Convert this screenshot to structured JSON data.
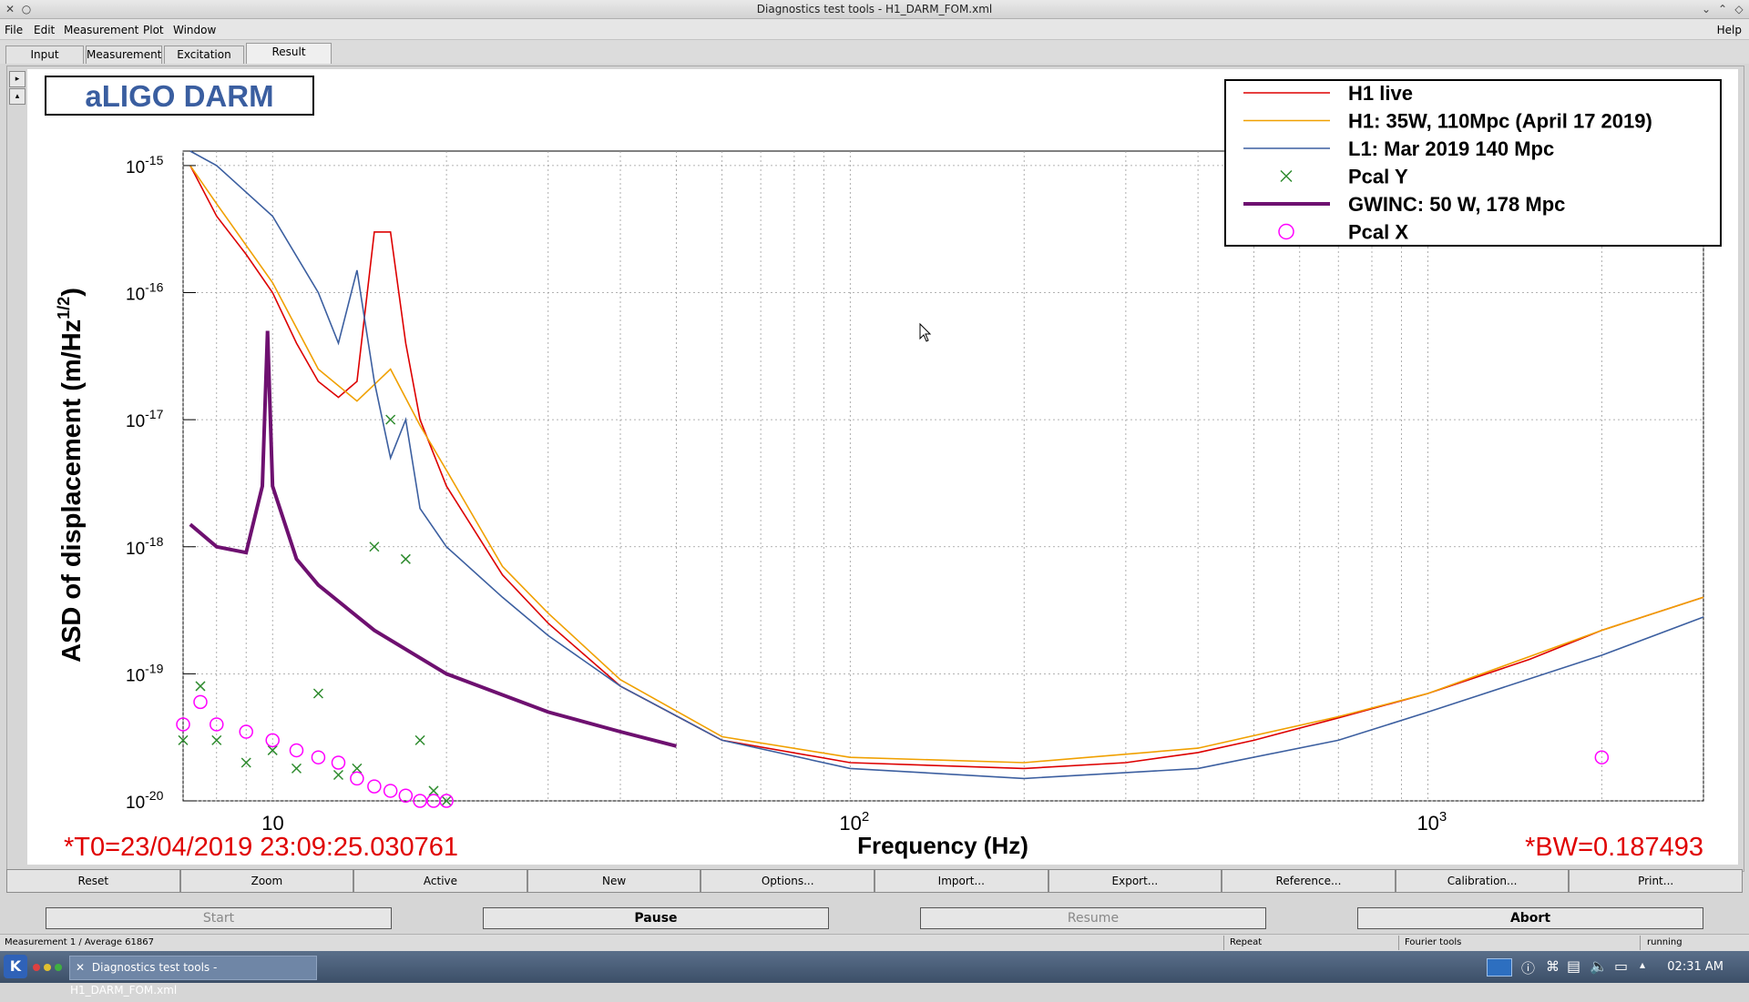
{
  "window": {
    "title": "Diagnostics test tools - H1_DARM_FOM.xml"
  },
  "menu": {
    "file": "File",
    "edit": "Edit",
    "measurement": "Measurement",
    "plot": "Plot",
    "window": "Window",
    "help": "Help"
  },
  "tabs": [
    {
      "label": "Input"
    },
    {
      "label": "Measurement"
    },
    {
      "label": "Excitation"
    },
    {
      "label": "Result"
    }
  ],
  "plot": {
    "badge": "aLIGO DARM",
    "t0": "*T0=23/04/2019 23:09:25.030761",
    "bw": "*BW=0.187493"
  },
  "chart_data": {
    "type": "line",
    "title": "",
    "xlabel": "Frequency (Hz)",
    "ylabel": "ASD of displacement (m/Hz",
    "ylabel_sup": "1/2",
    "ylabel_end": ")",
    "xscale": "log",
    "yscale": "log",
    "xlim": [
      7,
      3000
    ],
    "ylim": [
      1e-20,
      1.3e-15
    ],
    "grid": true,
    "legend_position": "top-right",
    "x_ticks": [
      {
        "label": "10",
        "exp": ""
      },
      {
        "label": "10",
        "exp": "2"
      },
      {
        "label": "10",
        "exp": "3"
      }
    ],
    "y_ticks": [
      {
        "base": "10",
        "exp": "-15"
      },
      {
        "base": "10",
        "exp": "-16"
      },
      {
        "base": "10",
        "exp": "-17"
      },
      {
        "base": "10",
        "exp": "-18"
      },
      {
        "base": "10",
        "exp": "-19"
      },
      {
        "base": "10",
        "exp": "-20"
      }
    ],
    "series": [
      {
        "name": "H1 live",
        "color": "#dd0000",
        "marker": "line",
        "x": [
          7.2,
          8,
          9,
          10,
          11,
          12,
          13,
          14,
          15,
          16,
          17,
          18,
          20,
          25,
          30,
          40,
          60,
          100,
          200,
          300,
          400,
          500,
          700,
          1000,
          1500,
          2000,
          3000
        ],
        "y": [
          1e-15,
          4e-16,
          2e-16,
          1e-16,
          4e-17,
          2e-17,
          1.5e-17,
          2e-17,
          3e-16,
          3e-16,
          4e-17,
          1e-17,
          3e-18,
          6e-19,
          2.5e-19,
          8e-20,
          3e-20,
          2e-20,
          1.8e-20,
          2e-20,
          2.4e-20,
          3e-20,
          4.5e-20,
          7e-20,
          1.3e-19,
          2.2e-19,
          4e-19
        ]
      },
      {
        "name": "H1: 35W, 110Mpc (April 17 2019)",
        "color": "#f0a000",
        "marker": "line",
        "x": [
          7.2,
          8,
          10,
          12,
          14,
          16,
          18,
          20,
          25,
          30,
          40,
          60,
          100,
          200,
          400,
          700,
          1000,
          2000,
          3000
        ],
        "y": [
          1e-15,
          5e-16,
          1.2e-16,
          2.5e-17,
          1.4e-17,
          2.5e-17,
          9e-18,
          4e-18,
          7e-19,
          3e-19,
          9e-20,
          3.2e-20,
          2.2e-20,
          2e-20,
          2.6e-20,
          4.6e-20,
          7e-20,
          2.2e-19,
          4e-19
        ]
      },
      {
        "name": "L1: Mar 2019 140 Mpc",
        "color": "#3c5fa0",
        "marker": "line",
        "x": [
          7.2,
          8,
          10,
          12,
          13,
          14,
          15,
          16,
          17,
          18,
          20,
          25,
          30,
          40,
          60,
          100,
          200,
          400,
          700,
          1000,
          2000,
          3000
        ],
        "y": [
          1.3e-15,
          1e-15,
          4e-16,
          1e-16,
          4e-17,
          1.5e-16,
          2e-17,
          5e-18,
          1e-17,
          2e-18,
          1e-18,
          4e-19,
          2e-19,
          8e-20,
          3e-20,
          1.8e-20,
          1.5e-20,
          1.8e-20,
          3e-20,
          5e-20,
          1.4e-19,
          2.8e-19
        ]
      },
      {
        "name": "Pcal Y",
        "color": "#2e8b2e",
        "marker": "x",
        "x": [
          7,
          7.5,
          8,
          9,
          10,
          11,
          12,
          13,
          14,
          15,
          16,
          17,
          18,
          19,
          20
        ],
        "y": [
          3e-20,
          8e-20,
          3e-20,
          2e-20,
          2.5e-20,
          1.8e-20,
          7e-20,
          1.6e-20,
          1.8e-20,
          1e-18,
          1e-17,
          8e-19,
          3e-20,
          1.2e-20,
          1e-20
        ]
      },
      {
        "name": "GWINC: 50 W, 178 Mpc",
        "color": "#6e1070",
        "marker": "thick",
        "x": [
          7.2,
          8,
          9,
          9.6,
          9.8,
          10,
          11,
          12,
          15,
          20,
          30,
          40,
          50
        ],
        "y": [
          1.5e-18,
          1e-18,
          9e-19,
          3e-18,
          5e-17,
          3e-18,
          8e-19,
          5e-19,
          2.2e-19,
          1e-19,
          5e-20,
          3.5e-20,
          2.7e-20
        ]
      },
      {
        "name": "Pcal X",
        "color": "#ff00ff",
        "marker": "o",
        "x": [
          7,
          7.5,
          8,
          9,
          10,
          11,
          12,
          13,
          14,
          15,
          16,
          17,
          18,
          19,
          20,
          2000
        ],
        "y": [
          4e-20,
          6e-20,
          4e-20,
          3.5e-20,
          3e-20,
          2.5e-20,
          2.2e-20,
          2e-20,
          1.5e-20,
          1.3e-20,
          1.2e-20,
          1.1e-20,
          1e-20,
          1e-20,
          1e-20,
          2.2e-20
        ]
      }
    ]
  },
  "toolbar": [
    "Reset",
    "Zoom",
    "Active",
    "New",
    "Options...",
    "Import...",
    "Export...",
    "Reference...",
    "Calibration...",
    "Print..."
  ],
  "controls": {
    "start": "Start",
    "pause": "Pause",
    "resume": "Resume",
    "abort": "Abort"
  },
  "status": {
    "measurement": "Measurement 1 / Average 61867",
    "repeat": "Repeat",
    "tools": "Fourier tools",
    "state": "running"
  },
  "taskbar": {
    "task": "Diagnostics test tools - H1_DARM_FOM.xml",
    "clock": "02:31 AM"
  }
}
